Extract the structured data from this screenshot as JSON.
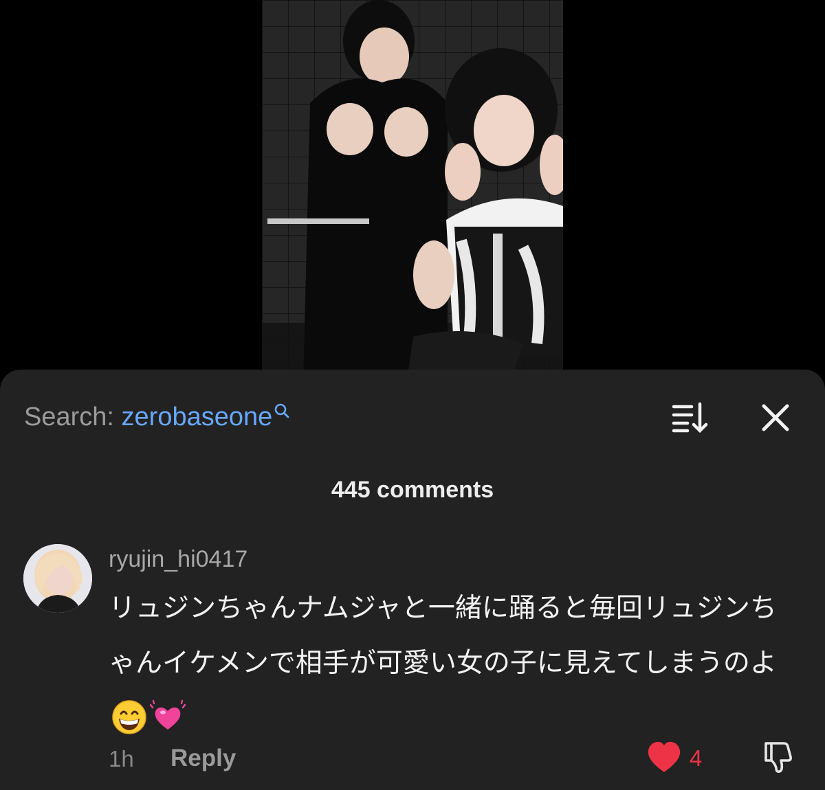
{
  "search": {
    "prefix": "Search:",
    "query": "zerobaseone"
  },
  "header": {
    "comment_count": "445 comments"
  },
  "comment": {
    "username": "ryujin_hi0417",
    "text": "リュジンちゃんナムジャと一緒に踊ると毎回リュジンちゃんイケメンで相手が可愛い女の子に見えてしまうのよ",
    "emojis": [
      "grinning-face-emoji",
      "beating-heart-emoji"
    ],
    "timestamp": "1h",
    "reply_label": "Reply",
    "like_count": "4"
  },
  "colors": {
    "sheet_background": "#222222",
    "search_query": "#66a8ff",
    "like_red": "#ee3346"
  }
}
